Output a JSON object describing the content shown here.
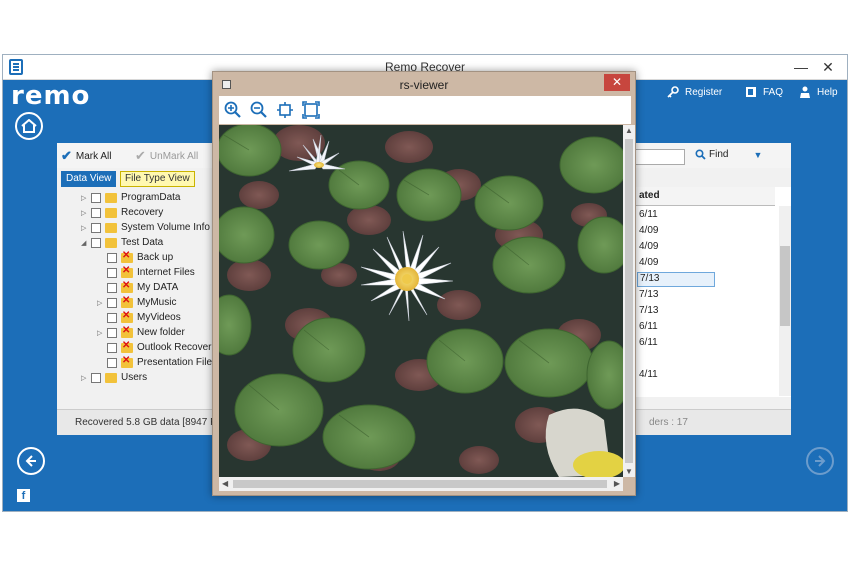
{
  "app": {
    "title": "Remo Recover",
    "logo_text": "remo",
    "minimize_label": "—",
    "close_label": "✕",
    "accent_color": "#1c6eb8",
    "links": [
      {
        "label": "Register",
        "icon": "key-icon"
      },
      {
        "label": "FAQ",
        "icon": "book-icon"
      },
      {
        "label": "Help",
        "icon": "person-icon"
      }
    ]
  },
  "toolbar": {
    "mark_all": "Mark All",
    "unmark_all": "UnMark All",
    "find_label": "Find",
    "find_dropdown": "▼"
  },
  "tabs": {
    "data_view": "Data View",
    "file_type_view": "File Type View"
  },
  "tree": {
    "items": [
      {
        "label": "ProgramData",
        "expander": "▷",
        "deleted": false
      },
      {
        "label": "Recovery",
        "expander": "▷",
        "deleted": false
      },
      {
        "label": "System Volume Info",
        "expander": "▷",
        "deleted": false
      },
      {
        "label": "Test Data",
        "expander": "◢",
        "deleted": false
      },
      {
        "label": "Back up",
        "expander": "",
        "deleted": true
      },
      {
        "label": "Internet Files",
        "expander": "",
        "deleted": true
      },
      {
        "label": "My DATA",
        "expander": "",
        "deleted": true
      },
      {
        "label": "MyMusic",
        "expander": "▷",
        "deleted": true
      },
      {
        "label": "MyVideos",
        "expander": "",
        "deleted": true
      },
      {
        "label": "New folder",
        "expander": "▷",
        "deleted": true
      },
      {
        "label": "Outlook Recover",
        "expander": "",
        "deleted": true
      },
      {
        "label": "Presentation File",
        "expander": "",
        "deleted": true
      },
      {
        "label": "Users",
        "expander": "▷",
        "deleted": false
      }
    ]
  },
  "grid": {
    "header": "ated",
    "rows": [
      "6/11",
      "4/09",
      "4/09",
      "4/09",
      "7/13",
      "7/13",
      "7/13",
      "6/11",
      "6/11",
      "",
      "4/11"
    ],
    "selected_row": 4
  },
  "status": {
    "recovered_text": "Recovered 5.8 GB data [8947 Fil",
    "folders_text": "ders : 17"
  },
  "viewer": {
    "title": "rs-viewer",
    "close_label": "✕",
    "tools": [
      {
        "icon": "zoom-in-icon"
      },
      {
        "icon": "zoom-out-icon"
      },
      {
        "icon": "fit-to-window-icon"
      },
      {
        "icon": "actual-size-icon"
      }
    ]
  },
  "facebook": "f"
}
